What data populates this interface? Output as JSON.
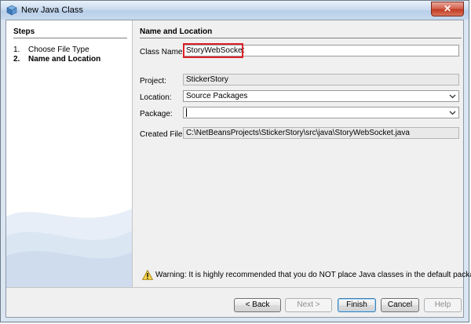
{
  "window": {
    "title": "New Java Class",
    "close_label": "✕"
  },
  "steps": {
    "title": "Steps",
    "items": [
      {
        "num": "1.",
        "label": "Choose File Type"
      },
      {
        "num": "2.",
        "label": "Name and Location"
      }
    ]
  },
  "form": {
    "title": "Name and Location",
    "class_name_label": "Class Name:",
    "class_name_value": "StoryWebSocket",
    "project_label": "Project:",
    "project_value": "StickerStory",
    "location_label": "Location:",
    "location_value": "Source Packages",
    "package_label": "Package:",
    "package_value": "",
    "created_file_label": "Created File:",
    "created_file_value": "C:\\NetBeansProjects\\StickerStory\\src\\java\\StoryWebSocket.java",
    "warning_text": "Warning: It is highly recommended that you do NOT place Java classes in the default package."
  },
  "buttons": {
    "back": "< Back",
    "next": "Next >",
    "finish": "Finish",
    "cancel": "Cancel",
    "help": "Help"
  }
}
